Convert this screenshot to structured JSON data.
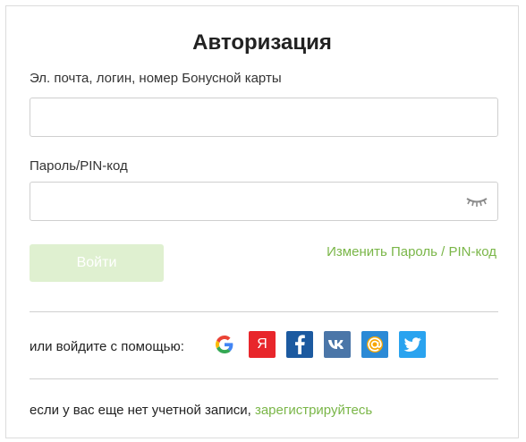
{
  "title": "Авторизация",
  "login": {
    "label": "Эл. почта, логин, номер Бонусной карты",
    "value": "",
    "placeholder": ""
  },
  "password": {
    "label": "Пароль/PIN-код",
    "value": "",
    "placeholder": "",
    "toggle_icon": "eye-closed-icon"
  },
  "actions": {
    "submit_label": "Войти",
    "change_password_label": "Изменить Пароль / PIN-код"
  },
  "social": {
    "label": "или войдите с помощью:",
    "providers": [
      {
        "name": "google",
        "icon": "google-icon",
        "glyph": "G",
        "color": "#ea4335"
      },
      {
        "name": "yandex",
        "icon": "yandex-icon",
        "glyph": "Я",
        "color": "#e8262b"
      },
      {
        "name": "facebook",
        "icon": "facebook-icon",
        "glyph": "f",
        "color": "#1c5aa0"
      },
      {
        "name": "vk",
        "icon": "vk-icon",
        "glyph": "vk",
        "color": "#4b76a8"
      },
      {
        "name": "mail",
        "icon": "mail-ru-icon",
        "glyph": "@",
        "color": "#2b8ad6"
      },
      {
        "name": "twitter",
        "icon": "twitter-icon",
        "glyph": "",
        "color": "#2aa3ef"
      }
    ]
  },
  "footer": {
    "text": "если у вас еще нет учетной записи,",
    "register_label": "зарегистрируйтесь"
  },
  "colors": {
    "accent": "#7ab648",
    "button_disabled": "#dff0d0",
    "border": "#cfcfcf"
  }
}
